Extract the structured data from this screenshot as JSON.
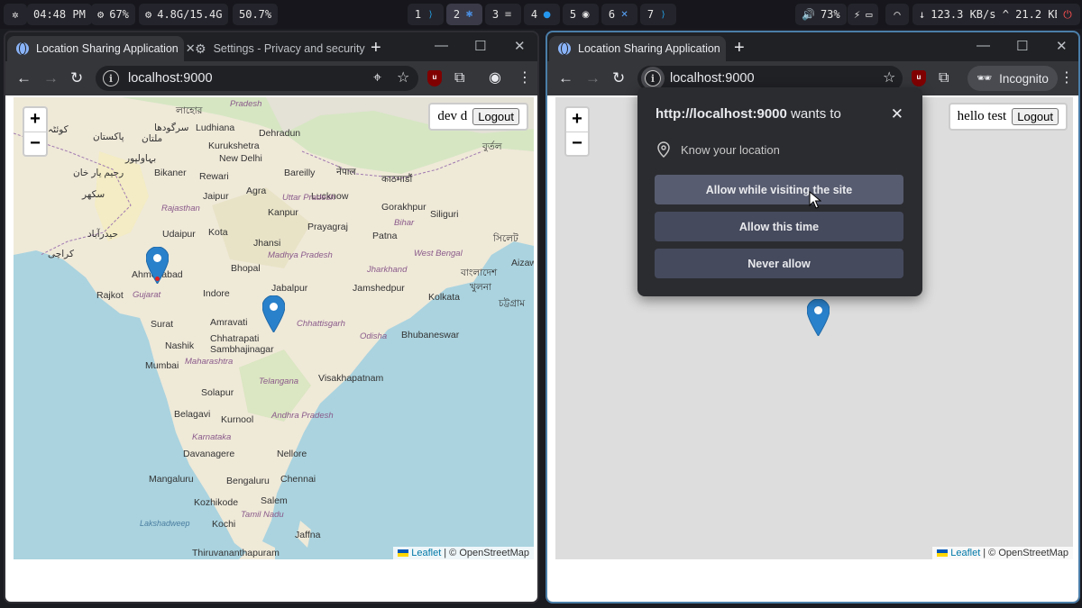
{
  "sysbar": {
    "time": "04:48 PM",
    "cpu": "67%",
    "mem": "4.8G/15.4G",
    "mem_pct": "50.7%",
    "workspaces": [
      {
        "num": "1",
        "icon": "vscode-icon"
      },
      {
        "num": "2",
        "icon": "snowflake-icon"
      },
      {
        "num": "3",
        "icon": "terminal-icon"
      },
      {
        "num": "4",
        "icon": "docker-icon"
      },
      {
        "num": "5",
        "icon": "obs-icon"
      },
      {
        "num": "6",
        "icon": "xcode-icon"
      },
      {
        "num": "7",
        "icon": "vscode-icon"
      }
    ],
    "volume": "73%",
    "net": "123.3 KB/s ^ 21.2 KB/:"
  },
  "left_window": {
    "tabs": [
      {
        "label": "Location Sharing Application"
      },
      {
        "label": "Settings - Privacy and security"
      }
    ],
    "url": "localhost:9000",
    "user_name": "dev d",
    "logout_label": "Logout"
  },
  "right_window": {
    "tabs": [
      {
        "label": "Location Sharing Application"
      }
    ],
    "url": "localhost:9000",
    "incognito_label": "Incognito",
    "user_name": "hello test",
    "logout_label": "Logout"
  },
  "map": {
    "zoom_in": "+",
    "zoom_out": "−",
    "attribution_leaflet": "Leaflet",
    "attribution_sep": "| © OpenStreetMap",
    "cities": [
      "Ludhiana",
      "Dehradun",
      "Kurukshetra",
      "New Delhi",
      "Bikaner",
      "Rewari",
      "Bareilly",
      "Jaipur",
      "Agra",
      "Kanpur",
      "Gorakhpur",
      "Siliguri",
      "Prayagraj",
      "Kota",
      "Jhansi",
      "Patna",
      "Udaipur",
      "Ahmedabad",
      "Bhopal",
      "Indore",
      "Jabalpur",
      "Jamshedpur",
      "Kolkata",
      "Rajkot",
      "Surat",
      "Amravati",
      "Nashik",
      "Chhatrapati",
      "Sambhajinagar",
      "Bhubaneswar",
      "Mumbai",
      "Visakhapatnam",
      "Solapur",
      "Belagavi",
      "Kurnool",
      "Nellore",
      "Davanagere",
      "Mangaluru",
      "Bengaluru",
      "Chennai",
      "Kozhikode",
      "Salem",
      "Kochi",
      "Jaffna",
      "Thiruvananthapuram",
      "Aizaw",
      "Lucknow"
    ],
    "regions": [
      "Pradesh",
      "Uttar Pradesh",
      "Rajasthan",
      "Bihar",
      "Madhya Pradesh",
      "West Bengal",
      "Jharkhand",
      "Gujarat",
      "Chhattisgarh",
      "Odisha",
      "Maharashtra",
      "Telangana",
      "Andhra Pradesh",
      "Karnataka",
      "Tamil Nadu",
      "Lakshadweep"
    ],
    "foreign": [
      "کراچی",
      "پاکستان",
      "ملتان",
      "بہاولپور",
      "رحیم یار خان",
      "سکھر",
      "حیدرآباد",
      "کوئٹہ",
      "سرگودھا",
      "লাহোর",
      "বাংলাদেশ",
      "চট্টগ্রাম",
      "খুলনা",
      "সিলেট",
      "काठमाडौं",
      "नेपाल",
      "বুর্তল"
    ]
  },
  "permission": {
    "origin": "http://localhost:9000",
    "wants_to": "wants to",
    "capability": "Know your location",
    "buttons": [
      "Allow while visiting the site",
      "Allow this time",
      "Never allow"
    ]
  }
}
